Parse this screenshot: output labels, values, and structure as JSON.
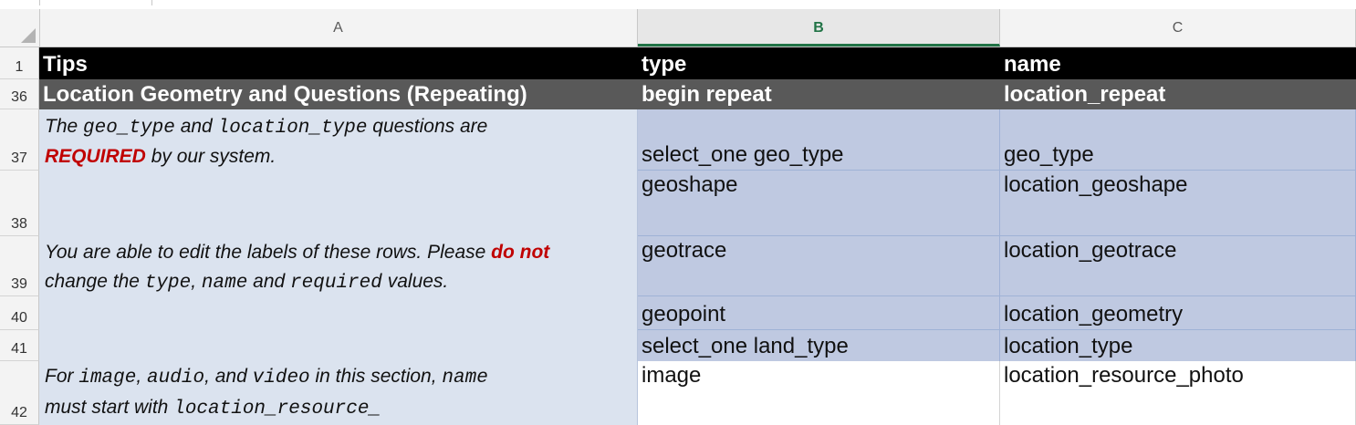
{
  "columns": {
    "a": "A",
    "b": "B",
    "c": "C"
  },
  "rows": {
    "r1": "1",
    "r36": "36",
    "r37": "37",
    "r38": "38",
    "r39": "39",
    "r40": "40",
    "r41": "41",
    "r42": "42"
  },
  "header": {
    "tips": "Tips",
    "type": "type",
    "name": "name"
  },
  "section": {
    "title": "Location Geometry and Questions (Repeating)",
    "type": "begin repeat",
    "name": "location_repeat"
  },
  "tips": {
    "t1_a": "The",
    "t1_code1": "geo_type",
    "t1_b": "and",
    "t1_code2": "location_type",
    "t1_c": "questions are",
    "t1_red": "REQUIRED",
    "t1_d": "by our system.",
    "t2_a": "You are able to edit the labels of these rows. Please",
    "t2_red": "do not",
    "t2_b": "change the",
    "t2_code1": "type",
    "t2_comma": ",",
    "t2_code2": "name",
    "t2_c": "and",
    "t2_code3": "required",
    "t2_d": "values.",
    "t3_a": "For",
    "t3_code1": "image",
    "t3_comma1": ",",
    "t3_code2": "audio",
    "t3_comma2": ",",
    "t3_b": "and",
    "t3_code3": "video",
    "t3_c": "in this section,",
    "t3_code4": "name",
    "t3_d": "must start with",
    "t3_code5": "location_resource_"
  },
  "data_rows": [
    {
      "type": "select_one geo_type",
      "name": "geo_type"
    },
    {
      "type": "geoshape",
      "name": "location_geoshape"
    },
    {
      "type": "geotrace",
      "name": "location_geotrace"
    },
    {
      "type": "geopoint",
      "name": "location_geometry"
    },
    {
      "type": "select_one land_type",
      "name": "location_type"
    },
    {
      "type": "image",
      "name": "location_resource_photo"
    }
  ],
  "colors": {
    "header_bg": "#000000",
    "section_bg": "#595959",
    "blue_cell": "#bfc9e1",
    "tips_bg": "#dbe3ef",
    "required_red": "#c00000",
    "active_col": "#217346"
  }
}
